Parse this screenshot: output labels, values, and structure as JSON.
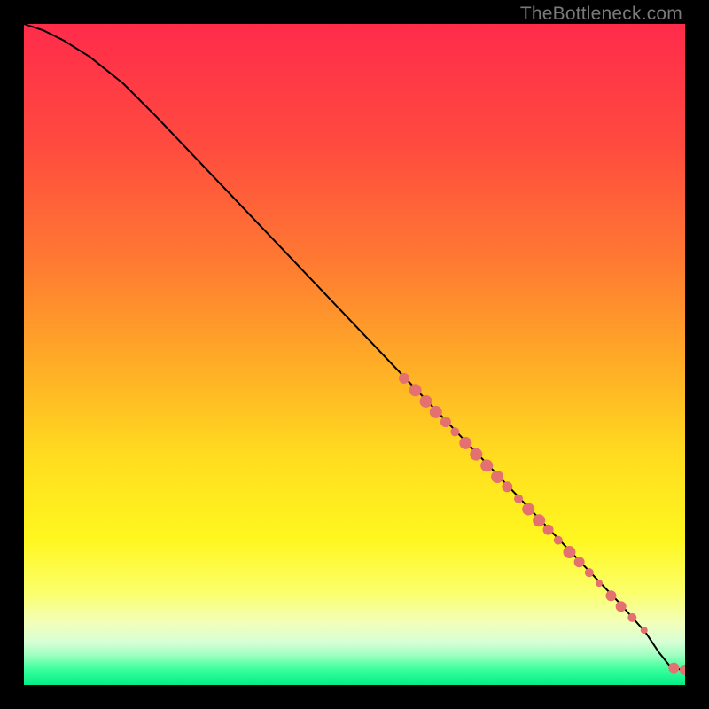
{
  "watermark": "TheBottleneck.com",
  "colors": {
    "marker": "#e4716f",
    "line": "#000000",
    "gradient_stops": [
      {
        "offset": 0.0,
        "color": "#ff2b4b"
      },
      {
        "offset": 0.18,
        "color": "#ff4a3f"
      },
      {
        "offset": 0.36,
        "color": "#ff7a32"
      },
      {
        "offset": 0.52,
        "color": "#ffae26"
      },
      {
        "offset": 0.66,
        "color": "#ffde1f"
      },
      {
        "offset": 0.78,
        "color": "#fff71f"
      },
      {
        "offset": 0.86,
        "color": "#fbff6b"
      },
      {
        "offset": 0.905,
        "color": "#f3ffb9"
      },
      {
        "offset": 0.935,
        "color": "#d7ffd6"
      },
      {
        "offset": 0.955,
        "color": "#9dffc0"
      },
      {
        "offset": 0.975,
        "color": "#3fff9e"
      },
      {
        "offset": 1.0,
        "color": "#00ef86"
      }
    ]
  },
  "chart_data": {
    "type": "line",
    "title": "",
    "xlabel": "",
    "ylabel": "",
    "xlim": [
      0,
      100
    ],
    "ylim": [
      0,
      100
    ],
    "series": [
      {
        "name": "curve",
        "kind": "line",
        "x": [
          0,
          3,
          6,
          10,
          15,
          20,
          30,
          40,
          50,
          60,
          70,
          80,
          90,
          94,
          96,
          98,
          100
        ],
        "y": [
          100,
          99,
          97.5,
          95,
          91,
          86,
          75.5,
          65,
          54.5,
          44,
          33.5,
          23,
          12.5,
          8,
          5,
          2.5,
          2.3
        ]
      },
      {
        "name": "markers",
        "kind": "scatter",
        "points": [
          {
            "x": 57.5,
            "y": 46.4,
            "r": 6
          },
          {
            "x": 59.2,
            "y": 44.6,
            "r": 7
          },
          {
            "x": 60.8,
            "y": 42.9,
            "r": 7
          },
          {
            "x": 62.3,
            "y": 41.3,
            "r": 7
          },
          {
            "x": 63.8,
            "y": 39.8,
            "r": 6
          },
          {
            "x": 65.2,
            "y": 38.3,
            "r": 5
          },
          {
            "x": 66.8,
            "y": 36.6,
            "r": 7
          },
          {
            "x": 68.4,
            "y": 34.9,
            "r": 7
          },
          {
            "x": 70.0,
            "y": 33.2,
            "r": 7
          },
          {
            "x": 71.6,
            "y": 31.5,
            "r": 7
          },
          {
            "x": 73.1,
            "y": 30.0,
            "r": 6
          },
          {
            "x": 74.8,
            "y": 28.2,
            "r": 5
          },
          {
            "x": 76.3,
            "y": 26.6,
            "r": 7
          },
          {
            "x": 77.9,
            "y": 24.9,
            "r": 7
          },
          {
            "x": 79.3,
            "y": 23.5,
            "r": 6
          },
          {
            "x": 80.8,
            "y": 21.9,
            "r": 5
          },
          {
            "x": 82.5,
            "y": 20.1,
            "r": 7
          },
          {
            "x": 84.0,
            "y": 18.6,
            "r": 6
          },
          {
            "x": 85.5,
            "y": 17.0,
            "r": 5
          },
          {
            "x": 87.0,
            "y": 15.4,
            "r": 4
          },
          {
            "x": 88.8,
            "y": 13.5,
            "r": 6
          },
          {
            "x": 90.3,
            "y": 11.9,
            "r": 6
          },
          {
            "x": 92.0,
            "y": 10.2,
            "r": 5
          },
          {
            "x": 93.8,
            "y": 8.3,
            "r": 4
          },
          {
            "x": 98.3,
            "y": 2.6,
            "r": 6
          },
          {
            "x": 100.0,
            "y": 2.3,
            "r": 6
          }
        ]
      }
    ]
  }
}
